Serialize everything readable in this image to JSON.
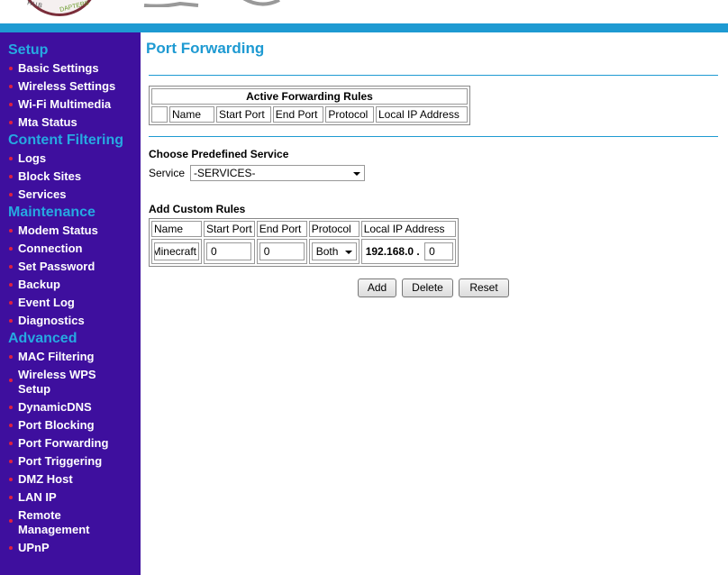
{
  "sidebar": {
    "sections": [
      {
        "title": "Setup",
        "items": [
          "Basic Settings",
          "Wireless Settings",
          "Wi-Fi Multimedia",
          "Mta Status"
        ]
      },
      {
        "title": "Content Filtering",
        "items": [
          "Logs",
          "Block Sites",
          "Services"
        ]
      },
      {
        "title": "Maintenance",
        "items": [
          "Modem Status",
          "Connection",
          "Set Password",
          "Backup",
          "Event Log",
          "Diagnostics"
        ]
      },
      {
        "title": "Advanced",
        "items": [
          "MAC Filtering",
          "Wireless WPS Setup",
          "DynamicDNS",
          "Port Blocking",
          "Port Forwarding",
          "Port Triggering",
          "DMZ Host",
          "LAN IP",
          "Remote Management",
          "UPnP"
        ]
      }
    ]
  },
  "header": {
    "logo_text_1": "HUB",
    "logo_text_2": "DAPTERS"
  },
  "main": {
    "title": "Port Forwarding",
    "active_rules": {
      "heading": "Active Forwarding Rules",
      "columns": [
        "",
        "Name",
        "Start Port",
        "End Port",
        "Protocol",
        "Local IP Address"
      ]
    },
    "predefined": {
      "heading": "Choose Predefined Service",
      "label": "Service",
      "selected": "-SERVICES-"
    },
    "custom_rules": {
      "heading": "Add Custom Rules",
      "columns": [
        "Name",
        "Start Port",
        "End Port",
        "Protocol",
        "Local IP Address"
      ],
      "name_value": "Minecraft",
      "start_port": "0",
      "end_port": "0",
      "protocol": "Both",
      "ip_prefix": "192.168.0 .",
      "ip_last": "0"
    },
    "buttons": {
      "add": "Add",
      "delete": "Delete",
      "reset": "Reset"
    }
  },
  "colors": {
    "accent": "#1e9ad2",
    "sidebar_bg": "#3e0f9e",
    "section_title": "#26a9e1",
    "bullet": "#e02040"
  }
}
